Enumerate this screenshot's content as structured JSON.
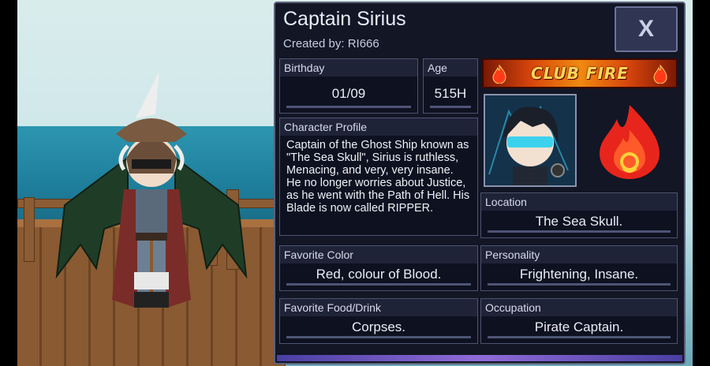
{
  "header": {
    "title": "Captain Sirius",
    "creator": "Created by: RI666",
    "close_label": "X"
  },
  "fields": {
    "birthday": {
      "label": "Birthday",
      "value": "01/09"
    },
    "age": {
      "label": "Age",
      "value": "515H"
    },
    "profile": {
      "label": "Character Profile",
      "value": "Captain of the Ghost Ship known as \"The Sea Skull\", Sirius is ruthless, Menacing, and very, very insane. He no longer worries about Justice, as he went with the Path of Hell. His Blade is now called RIPPER."
    },
    "location": {
      "label": "Location",
      "value": "The Sea Skull."
    },
    "favorite_color": {
      "label": "Favorite Color",
      "value": "Red, colour of Blood."
    },
    "personality": {
      "label": "Personality",
      "value": "Frightening, Insane."
    },
    "favorite_food": {
      "label": "Favorite Food/Drink",
      "value": "Corpses."
    },
    "occupation": {
      "label": "Occupation",
      "value": "Pirate Captain."
    }
  },
  "club": {
    "name": "CLUB FIRE",
    "icon": "fire-icon"
  },
  "colors": {
    "panel": "#121625",
    "accent": "#5b6078",
    "club_orange": "#f08a10"
  }
}
